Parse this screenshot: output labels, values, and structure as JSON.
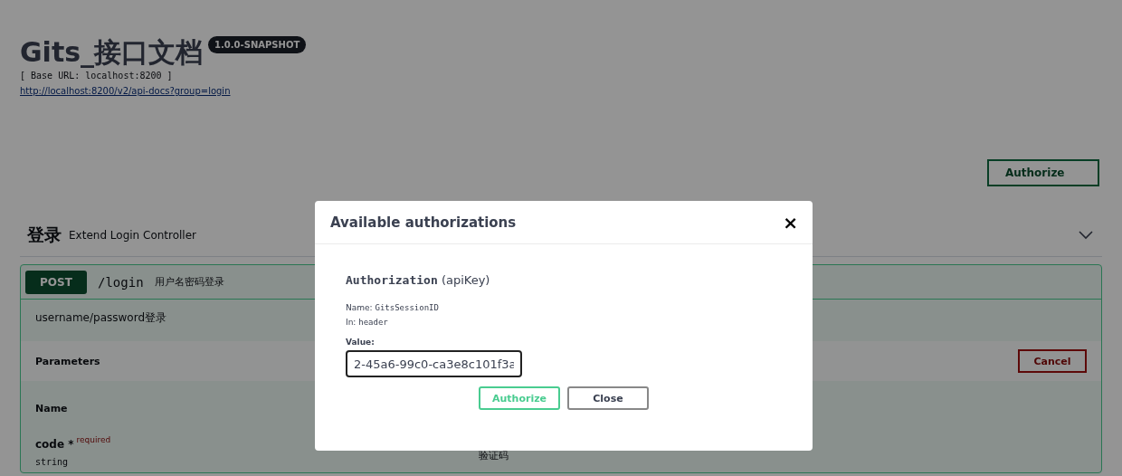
{
  "info": {
    "title": "Gits_接口文档",
    "version": "1.0.0-SNAPSHOT",
    "base_url": "[ Base URL: localhost:8200 ]",
    "docs_link": "http://localhost:8200/v2/api-docs?group=login"
  },
  "authorize_button": {
    "label": "Authorize"
  },
  "section": {
    "name": "登录",
    "description": "Extend Login Controller",
    "expanded": true
  },
  "operation": {
    "method": "POST",
    "path": "/login",
    "summary": "用户名密码登录",
    "description": "username/password登录",
    "parameters_title": "Parameters",
    "cancel_label": "Cancel",
    "columns": [
      "Name"
    ],
    "parameters": [
      {
        "name": "code",
        "required_mark": "*",
        "required_label": "required",
        "type": "string",
        "description": "验证码"
      }
    ]
  },
  "dialog": {
    "title": "Available authorizations",
    "close_symbol": "×",
    "scheme_title": "Authorization",
    "scheme_type": "(apiKey)",
    "name_label": "Name:",
    "name_value": "GitsSessionID",
    "in_label": "In:",
    "in_value": "header",
    "value_label": "Value:",
    "value": "2-45a6-99c0-ca3e8c101f3a",
    "buttons": [
      {
        "label": "Authorize",
        "kind": "primary"
      },
      {
        "label": "Close",
        "kind": "secondary"
      }
    ]
  }
}
